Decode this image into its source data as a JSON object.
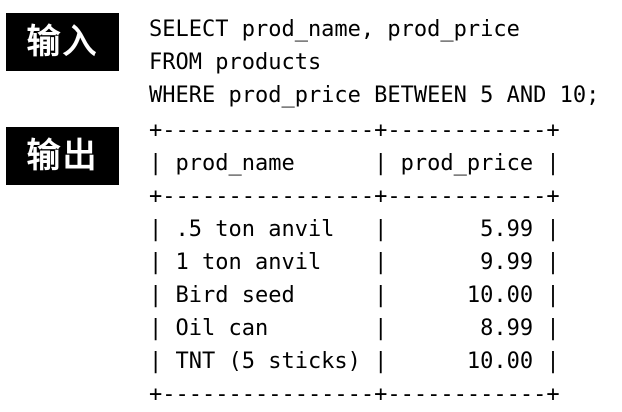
{
  "labels": {
    "input": "输入",
    "output": "输出"
  },
  "sql": {
    "lines": [
      "SELECT prod_name, prod_price",
      "FROM products",
      "WHERE prod_price BETWEEN 5 AND 10;"
    ]
  },
  "result": {
    "border_line": "+----------------+------------+",
    "header_row": "| prod_name      | prod_price |",
    "rows": [
      "| .5 ton anvil   |       5.99 |",
      "| 1 ton anvil    |       9.99 |",
      "| Bird seed      |      10.00 |",
      "| Oil can        |       8.99 |",
      "| TNT (5 sticks) |      10.00 |"
    ]
  }
}
